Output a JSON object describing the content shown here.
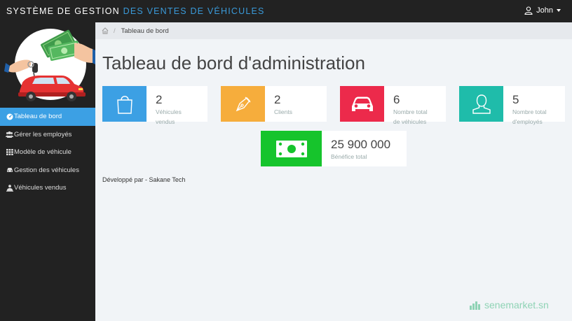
{
  "topbar": {
    "brand_part1": "SYSTÈME DE GESTION",
    "brand_part2": "DES VENTES DE VÉHICULES",
    "user_name": "John"
  },
  "sidebar": {
    "items": [
      {
        "label": "Tableau de bord",
        "icon": "dashboard-icon"
      },
      {
        "label": "Gérer les employés",
        "icon": "users-icon"
      },
      {
        "label": "Modèle de véhicule",
        "icon": "grid-icon"
      },
      {
        "label": "Gestion des véhicules",
        "icon": "car-icon"
      },
      {
        "label": "Véhicules vendus",
        "icon": "user-car-icon"
      }
    ]
  },
  "breadcrumb": {
    "home_icon": "home-icon",
    "current": "Tableau de bord"
  },
  "page": {
    "title": "Tableau de bord d'administration"
  },
  "cards": [
    {
      "value": "2",
      "label_line1": "Véhicules",
      "label_line2": "vendus",
      "color": "#3ca0e4",
      "icon": "shopping-bag-icon"
    },
    {
      "value": "2",
      "label_line1": "Clients",
      "label_line2": "",
      "color": "#f6ad3c",
      "icon": "pen-icon"
    },
    {
      "value": "6",
      "label_line1": "Nombre total",
      "label_line2": "de véhicules",
      "color": "#ec2a4b",
      "icon": "car-icon"
    },
    {
      "value": "5",
      "label_line1": "Nombre total",
      "label_line2": "d'employés",
      "color": "#1fbcaa",
      "icon": "user-icon"
    },
    {
      "value": "25 900 000",
      "label_line1": "Bénéfice total",
      "label_line2": "",
      "color": "#16c42c",
      "icon": "money-icon"
    }
  ],
  "footer": {
    "text": "Développé par - Sakane Tech"
  },
  "watermark": {
    "text": "senemarket.sn"
  }
}
